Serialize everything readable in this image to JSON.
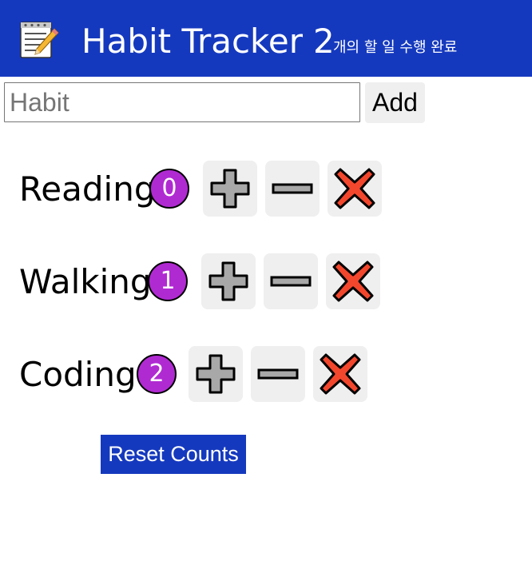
{
  "header": {
    "logo_icon": "memo-pencil-icon",
    "title": "Habit Tracker",
    "completed_count": "2",
    "completed_label": "개의 할 일 수행 완료"
  },
  "add_form": {
    "input_placeholder": "Habit",
    "input_value": "",
    "add_label": "Add"
  },
  "habits": [
    {
      "name": "Reading",
      "count": "0"
    },
    {
      "name": "Walking",
      "count": "1"
    },
    {
      "name": "Coding",
      "count": "2"
    }
  ],
  "habit_buttons": {
    "increase_icon": "plus-icon",
    "decrease_icon": "minus-icon",
    "delete_icon": "x-icon"
  },
  "reset_label": "Reset Counts",
  "colors": {
    "navbar": "#1539be",
    "count_badge": "#b02ad2",
    "delete_red": "#f2472d",
    "icon_gray": "#a8a8a8"
  }
}
